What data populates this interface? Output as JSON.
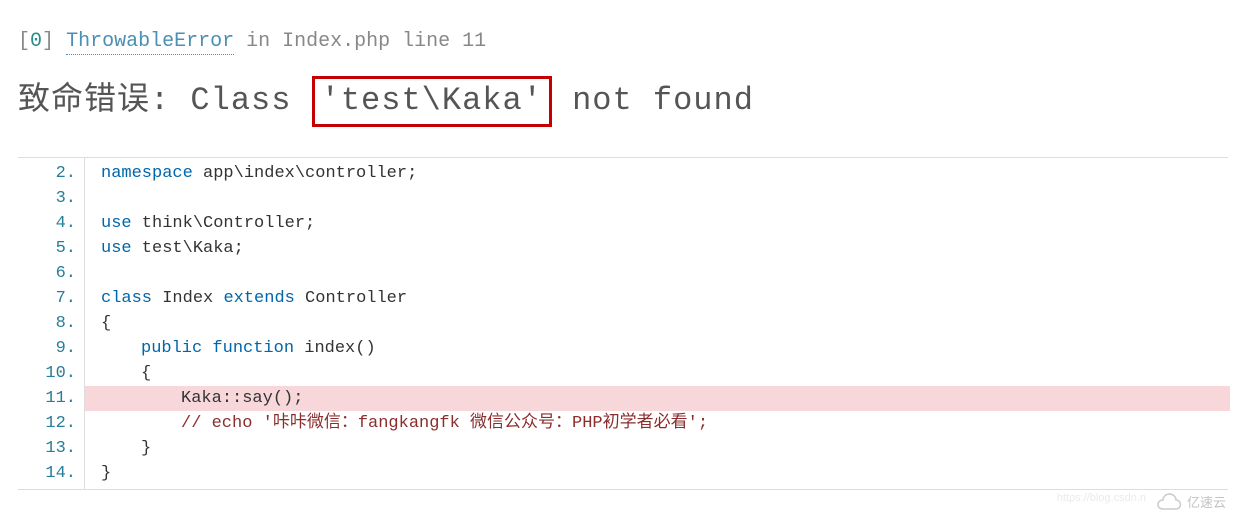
{
  "header": {
    "bracket_open": "[",
    "index": "0",
    "bracket_close": "]",
    "error_type": "ThrowableError",
    "in": "in",
    "location": "Index.php line 11"
  },
  "title": {
    "prefix": "致命错误: Class ",
    "highlighted": "'test\\Kaka'",
    "suffix": " not found"
  },
  "code": {
    "line_numbers": [
      "2.",
      "3.",
      "4.",
      "5.",
      "6.",
      "7.",
      "8.",
      "9.",
      "10.",
      "11.",
      "12.",
      "13.",
      "14."
    ],
    "lines": {
      "l2_kw": "namespace",
      "l2_ns": " app\\index\\controller;",
      "l4_kw": "use",
      "l4_ns": " think\\Controller;",
      "l5_kw": "use",
      "l5_ns": " test\\Kaka;",
      "l7_kw1": "class",
      "l7_cls": " Index ",
      "l7_kw2": "extends",
      "l7_ext": " Controller",
      "l8": "{",
      "l9_kw1": "public",
      "l9_kw2": " function",
      "l9_fn": " index()",
      "l10": "{",
      "l11_cls": "Kaka",
      "l11_op": "::",
      "l11_fn": "say",
      "l11_end": "();",
      "l12": "// echo '咔咔微信：fangkangfk    微信公众号：PHP初学者必看';",
      "l13": "}",
      "l14": "}"
    }
  },
  "watermark": {
    "text": "亿速云",
    "csdn": "https://blog.csdn.n"
  }
}
